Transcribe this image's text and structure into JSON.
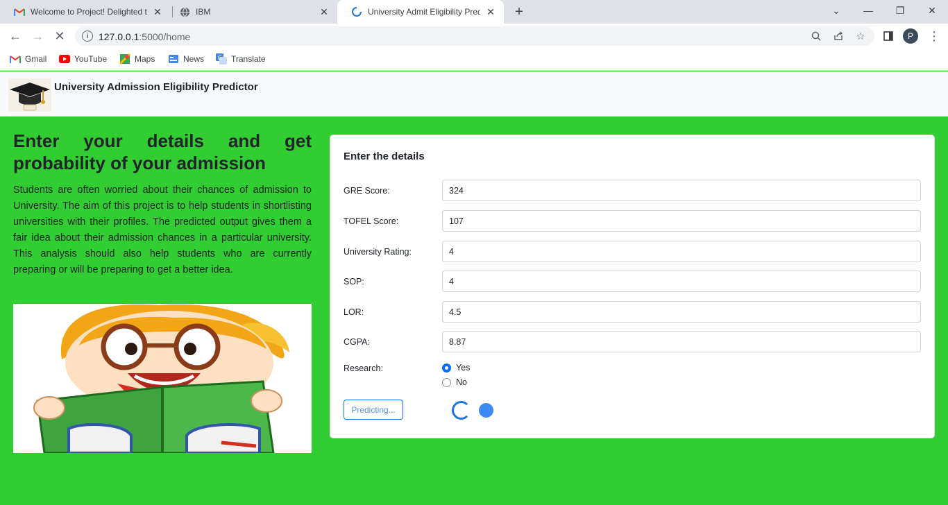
{
  "browser": {
    "tabs": [
      {
        "title": "Welcome to Project! Delighted to",
        "icon": "gmail-icon"
      },
      {
        "title": "IBM",
        "icon": "globe-icon"
      },
      {
        "title": "University Admit Eligibility Predic",
        "icon": "loading-icon"
      }
    ],
    "url_host": "127.0.0.1",
    "url_path": ":5000/home",
    "profile_initial": "P",
    "bookmarks": [
      {
        "label": "Gmail",
        "icon": "gmail-icon"
      },
      {
        "label": "YouTube",
        "icon": "youtube-icon"
      },
      {
        "label": "Maps",
        "icon": "maps-icon"
      },
      {
        "label": "News",
        "icon": "news-icon"
      },
      {
        "label": "Translate",
        "icon": "translate-icon"
      }
    ]
  },
  "navbar": {
    "brand": "University Admission Eligibility Predictor"
  },
  "hero": {
    "headline": "Enter your details and get probability of your admission",
    "description": "Students are often worried about their chances of admission to University. The aim of this project is to help students in shortlisting universities with their profiles. The predicted output gives them a fair idea about their admission chances in a particular university. This analysis should also help students who are currently preparing or will be preparing to get a better idea."
  },
  "form": {
    "title": "Enter the details",
    "fields": [
      {
        "label": "GRE Score:",
        "value": "324"
      },
      {
        "label": "TOFEL Score:",
        "value": "107"
      },
      {
        "label": "University Rating:",
        "value": "4"
      },
      {
        "label": "SOP:",
        "value": "4"
      },
      {
        "label": "LOR:",
        "value": "4.5"
      },
      {
        "label": "CGPA:",
        "value": "8.87"
      }
    ],
    "research": {
      "label": "Research:",
      "options": [
        "Yes",
        "No"
      ],
      "selected": "Yes"
    },
    "button_label": "Predicting..."
  },
  "colors": {
    "page_background": "#32cd32",
    "accent": "#0d6efd"
  }
}
